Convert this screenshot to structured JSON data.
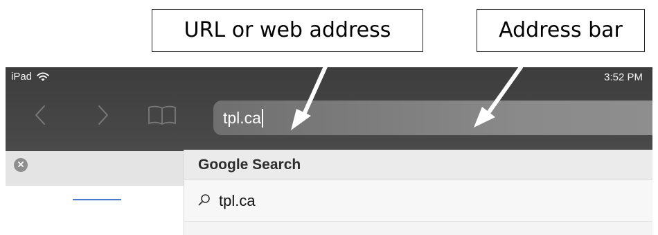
{
  "annotations": {
    "url_label": "URL or web address",
    "address_bar_label": "Address bar"
  },
  "status_bar": {
    "device": "iPad",
    "time": "3:52 PM",
    "wifi_icon": "wifi-icon"
  },
  "toolbar": {
    "back_icon": "chevron-left-icon",
    "forward_icon": "chevron-right-icon",
    "bookmarks_icon": "book-icon"
  },
  "address_bar": {
    "value": "tpl.ca"
  },
  "suggestions": {
    "header": "Google Search",
    "items": [
      {
        "icon": "search-icon",
        "text": "tpl.ca"
      }
    ]
  },
  "colors": {
    "toolbar_bg": "#444444",
    "address_bg": "#7d7d7d",
    "accent": "#4a78c8"
  }
}
